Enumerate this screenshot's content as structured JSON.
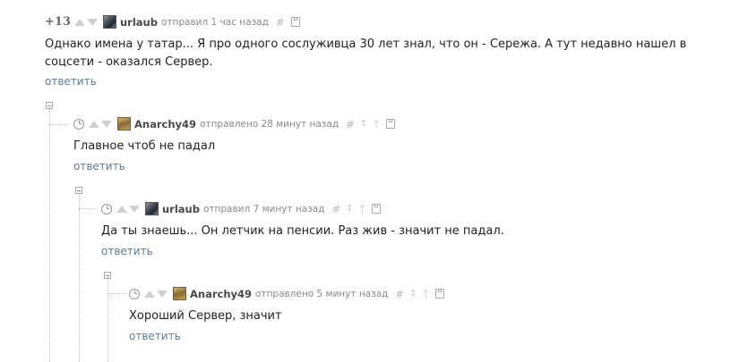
{
  "comments": [
    {
      "rating": "+13",
      "username": "urlaub",
      "meta": "отправил 1 час назад",
      "hash_icon": "#",
      "text": "Однако имена у татар... Я про одного сослуживца 30 лет знал, что он - Сережа. А тут недавно нашел в соцсети - оказался Сервер.",
      "reply_label": "ответить"
    },
    {
      "username": "Anarchy49",
      "meta": "отправлено 28 минут назад",
      "hash_icon": "#",
      "up_icon": "⍏",
      "branch_icon": "ᛘ",
      "text": "Главное чтоб не падал",
      "reply_label": "ответить"
    },
    {
      "username": "urlaub",
      "meta": "отправил 7 минут назад",
      "hash_icon": "#",
      "up_icon": "⍏",
      "branch_icon": "ᛘ",
      "text": "Да ты знаешь... Он летчик на пенсии. Раз жив - значит не падал.",
      "reply_label": "ответить"
    },
    {
      "username": "Anarchy49",
      "meta": "отправлено 5 минут назад",
      "hash_icon": "#",
      "up_icon": "⍏",
      "branch_icon": "ᛘ",
      "text": "Хороший Сервер, значит",
      "reply_label": "ответить"
    }
  ],
  "colors": {
    "link": "#5a7da0",
    "meta": "#8a8a8a",
    "username": "#4a4a4a",
    "vote_arrow": "#cfcfcf"
  }
}
